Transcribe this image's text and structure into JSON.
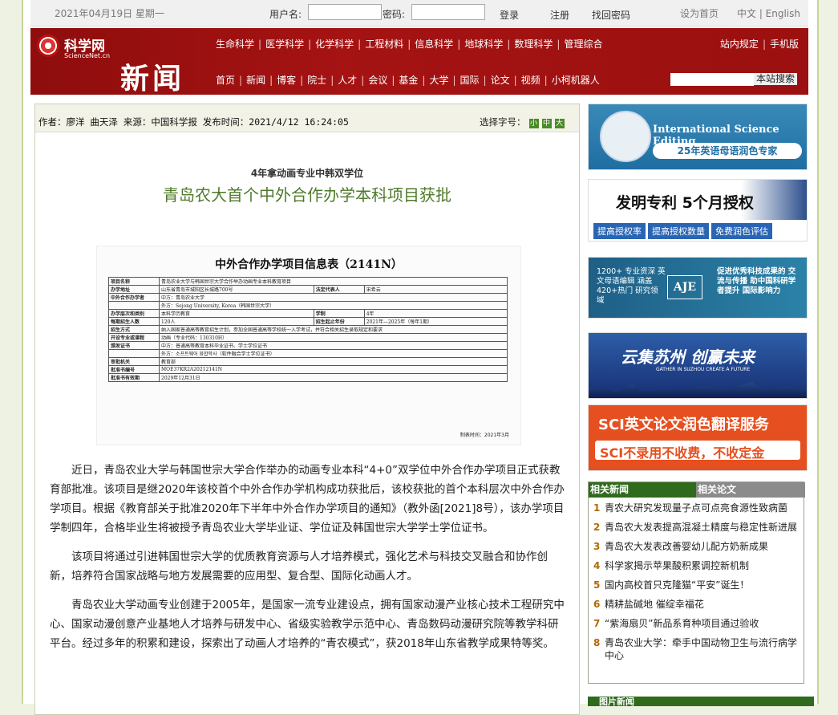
{
  "topbar": {
    "date": "2021年04月19日 星期一",
    "username_label": "用户名:",
    "password_label": "密码:",
    "login": "登录",
    "register": "注册",
    "recover": "找回密码",
    "homepage": "设为首页",
    "lang": "中文 | English"
  },
  "banner": {
    "logo_cn": "科学网",
    "logo_en": "ScienceNet.cn",
    "section": "新闻",
    "nav1": [
      "生命科学",
      "医学科学",
      "化学科学",
      "工程材料",
      "信息科学",
      "地球科学",
      "数理科学",
      "管理综合"
    ],
    "nav2": [
      "首页",
      "新闻",
      "博客",
      "院士",
      "人才",
      "会议",
      "基金",
      "大学",
      "国际",
      "论文",
      "视频",
      "小柯机器人"
    ],
    "right_links": [
      "站内规定",
      "手机版"
    ],
    "search_button": "本站搜索"
  },
  "article": {
    "meta": "作者：廖洋 曲天泽 来源：中国科学报 发布时间：2021/4/12 16:24:05",
    "font_label": "选择字号：",
    "font_sizes": [
      "小",
      "中",
      "大"
    ],
    "subhead": "4年拿动画专业中韩双学位",
    "headline": "青岛农大首个中外合作办学本科项目获批",
    "doc": {
      "title": "中外合作办学项目信息表（2141N）",
      "rows": [
        [
          "项目名称",
          "青岛农业大学与韩国世宗大学合作举办动画专业本科教育项目",
          "",
          ""
        ],
        [
          "办学地址",
          "山东省青岛市城阳区长城路700号",
          "法定代表人",
          "宋希云"
        ],
        [
          "中外合作办学者",
          "中方：青岛农业大学",
          "",
          ""
        ],
        [
          "",
          "外方：Sejong University, Korea（韩国世宗大学）",
          "",
          ""
        ],
        [
          "办学层次和类别",
          "本科学历教育",
          "学制",
          "4年"
        ],
        [
          "每期招生人数",
          "120人",
          "招生起止年份",
          "2021年—2025年（每年1期）"
        ],
        [
          "招生方式",
          "纳入国家普通高等教育招生计划，参加全国普通高等学校统一入学考试，并符合相关招生录取规定和要求",
          "",
          ""
        ],
        [
          "开设专业或课程",
          "动画（专业代码：130310H）",
          "",
          ""
        ],
        [
          "颁发证书",
          "中方：普通高等教育本科毕业证书、学士学位证书",
          "",
          ""
        ],
        [
          "",
          "外方：소프트웨어 융합학사（软件融合学士学位证书）",
          "",
          ""
        ],
        [
          "审批机关",
          "教育部",
          "",
          ""
        ],
        [
          "批准书编号",
          "MOE37KR2A20212141N",
          "",
          ""
        ],
        [
          "批准书有效期",
          "2029年12月31日",
          "",
          ""
        ]
      ],
      "footer": "制表时间：2021年3月"
    },
    "paragraphs": [
      "近日，青岛农业大学与韩国世宗大学合作举办的动画专业本科“4+0”双学位中外合作办学项目正式获教育部批准。该项目是继2020年该校首个中外合作办学机构成功获批后，该校获批的首个本科层次中外合作办学项目。根据《教育部关于批准2020年下半年中外合作办学项目的通知》（教外函[2021]8号），该办学项目学制四年，合格毕业生将被授予青岛农业大学毕业证、学位证及韩国世宗大学学士学位证书。",
      "该项目将通过引进韩国世宗大学的优质教育资源与人才培养模式，强化艺术与科技交叉融合和协作创新，培养符合国家战略与地方发展需要的应用型、复合型、国际化动画人才。",
      "青岛农业大学动画专业创建于2005年，是国家一流专业建设点，拥有国家动漫产业核心技术工程研究中心、国家动漫创意产业基地人才培养与研发中心、省级实验教学示范中心、青岛数码动漫研究院等教学科研平台。经过多年的积累和建设，探索出了动画人才培养的“青农模式”，获2018年山东省教学成果特等奖。"
    ]
  },
  "ads": {
    "a1_title": "International Science Editing",
    "a1_sub": "25年英语母语润色专家",
    "a2_title": "发明专利 5个月授权",
    "a2_buttons": [
      "提高授权率",
      "提高授权数量",
      "免费润色评估"
    ],
    "a3_left": "1200+ 专业资深 英文母语编辑 涵盖420+热门 研究领域",
    "a3_logo": "AJE",
    "a3_right": "促进优秀科技成果的 交流与传播 助中国科研学者提升 国际影响力",
    "a4_title": "云集苏州 创赢未来",
    "a4_sub": "GATHER IN SUZHOU CREATE A FUTURE",
    "a5_line1": "SCI英文论文润色翻译服务",
    "a5_line2": "SCI不录用不收费，不收定金"
  },
  "related": {
    "tab_news": "相关新闻",
    "tab_papers": "相关论文",
    "items": [
      "青农大研究发现量子点可点亮食源性致病菌",
      "青岛农大发表提高混凝土精度与稳定性新进展",
      "青岛农大发表改善婴幼儿配方奶新成果",
      "科学家揭示苹果酸积累调控新机制",
      "国内高校首只克隆猫“平安”诞生！",
      "精耕盐碱地 催绽幸福花",
      "“紫海扇贝”新品系育种项目通过验收",
      "青岛农业大学：牵手中国动物卫生与流行病学中心"
    ],
    "numbers": [
      "1",
      "2",
      "3",
      "4",
      "5",
      "6",
      "7",
      "8"
    ]
  },
  "pic_news": "图片新闻"
}
